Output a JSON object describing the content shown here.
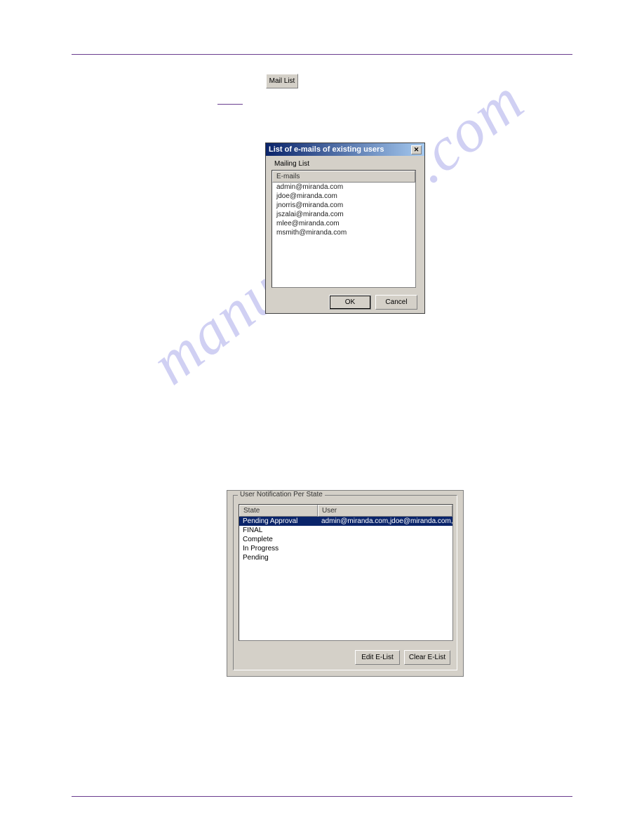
{
  "watermark": "manualshive.com",
  "toolbar": {
    "mail_list_label": "Mail List"
  },
  "dialog1": {
    "title": "List of e-mails of existing users",
    "group_label": "Mailing List",
    "column_header": "E-mails",
    "items": [
      "admin@miranda.com",
      "jdoe@miranda.com",
      "jnorris@miranda.com",
      "jszalai@miranda.com",
      "mlee@miranda.com",
      "msmith@miranda.com"
    ],
    "ok_label": "OK",
    "cancel_label": "Cancel"
  },
  "dialog2": {
    "legend": "User Notification Per State",
    "col_state": "State",
    "col_user": "User",
    "rows": [
      {
        "state": "Pending Approval",
        "user": "admin@miranda.com,jdoe@miranda.com,jn..."
      },
      {
        "state": "FINAL",
        "user": ""
      },
      {
        "state": "Complete",
        "user": ""
      },
      {
        "state": "In Progress",
        "user": ""
      },
      {
        "state": "Pending",
        "user": ""
      }
    ],
    "edit_label": "Edit E-List",
    "clear_label": "Clear E-List"
  }
}
